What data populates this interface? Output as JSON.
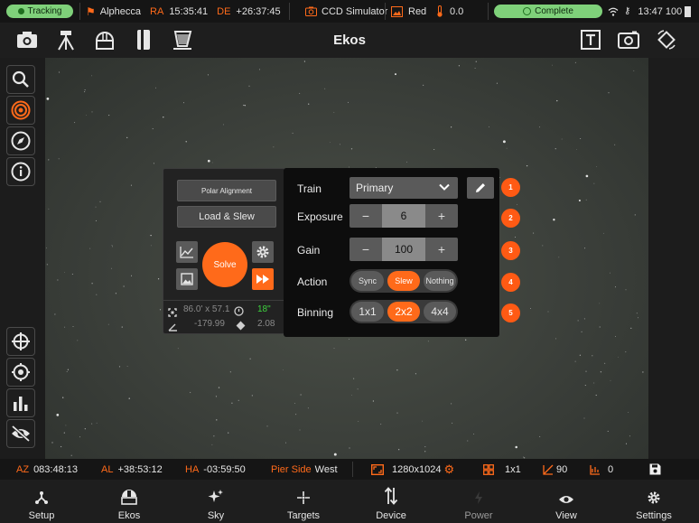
{
  "status_bar": {
    "tracking": "Tracking",
    "target_name": "Alphecca",
    "ra_label": "RA",
    "ra_value": "15:35:41",
    "de_label": "DE",
    "de_value": "+26:37:45",
    "camera": "CCD Simulator",
    "filter": "Red",
    "temperature": "0.0",
    "state": "Complete",
    "time_battery": "13:47 100"
  },
  "header": {
    "title": "Ekos"
  },
  "solver": {
    "polar_alignment": "Polar Alignment",
    "load_slew": "Load & Slew",
    "solve": "Solve",
    "fov": "86.0' x 57.1'",
    "pixscale": "18\"",
    "rotation": "-179.99",
    "pa_value": "2.08"
  },
  "settings": {
    "train_label": "Train",
    "train_value": "Primary",
    "exposure_label": "Exposure",
    "exposure_value": "6",
    "gain_label": "Gain",
    "gain_value": "100",
    "minus": "−",
    "plus": "+",
    "action_label": "Action",
    "actions": [
      "Sync",
      "Slew",
      "Nothing"
    ],
    "action_selected": "Slew",
    "binning_label": "Binning",
    "binnings": [
      "1x1",
      "2x2",
      "4x4"
    ],
    "binning_selected": "2x2",
    "badges": [
      "1",
      "2",
      "3",
      "4",
      "5"
    ]
  },
  "info_bar": {
    "az_label": "AZ",
    "az_value": "083:48:13",
    "al_label": "AL",
    "al_value": "+38:53:12",
    "ha_label": "HA",
    "ha_value": "-03:59:50",
    "pier_label": "Pier Side",
    "pier_value": "West",
    "resolution": "1280x1024",
    "binning": "1x1",
    "gain": "90",
    "offset": "0"
  },
  "nav": [
    "Setup",
    "Ekos",
    "Sky",
    "Targets",
    "Device",
    "Power",
    "View",
    "Settings"
  ],
  "colors": {
    "accent": "#ff6a1a",
    "green": "#5cc35c"
  }
}
